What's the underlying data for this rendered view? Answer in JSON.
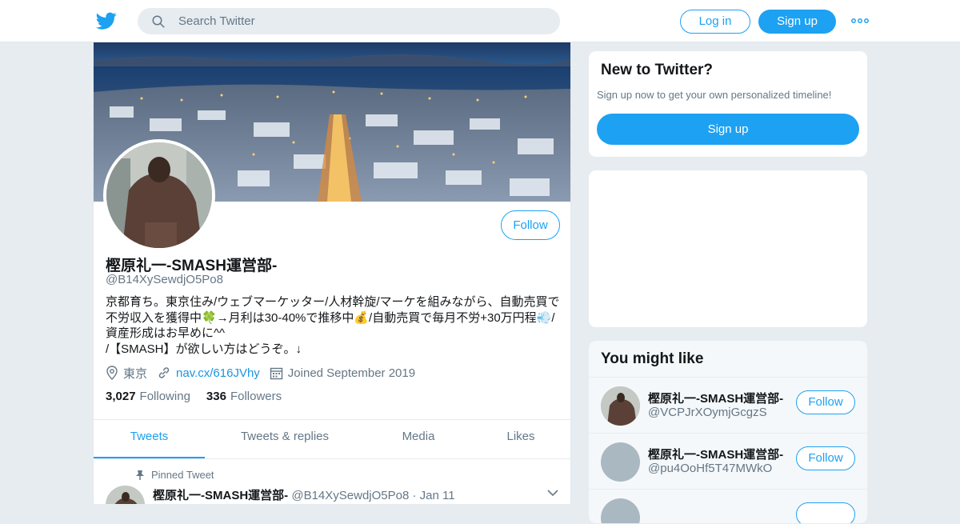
{
  "header": {
    "search_placeholder": "Search Twitter",
    "login_label": "Log in",
    "signup_label": "Sign up",
    "more_icon": "more-dots-icon"
  },
  "profile": {
    "name": "樫原礼一-SMASH運営部-",
    "handle": "@B14XySewdjO5Po8",
    "follow_label": "Follow",
    "bio_lines": [
      "京都育ち。東京住み/ウェブマーケッター/人材幹旋/マーケを組みながら、自動売買で",
      "不労収入を獲得中🍀→月利は30-40%で推移中💰/自動売買で毎月不労+30万円程💨/",
      "資産形成はお早めに^^",
      "/【SMASH】が欲しい方はどうぞ。↓"
    ],
    "location": "東京",
    "url": "nav.cx/616JVhy",
    "joined": "Joined September 2019",
    "following_count": "3,027",
    "following_label": "Following",
    "followers_count": "336",
    "followers_label": "Followers"
  },
  "tabs": [
    "Tweets",
    "Tweets & replies",
    "Media",
    "Likes"
  ],
  "pinned_tweet": {
    "label": "Pinned Tweet",
    "name": "樫原礼一-SMASH運営部-",
    "handle": "@B14XySewdjO5Po8",
    "separator": "·",
    "date": "Jan 11"
  },
  "new_to_twitter": {
    "title": "New to Twitter?",
    "subtitle": "Sign up now to get your own personalized timeline!",
    "button": "Sign up"
  },
  "you_might_like": {
    "title": "You might like",
    "items": [
      {
        "name": "樫原礼一-SMASH運営部-",
        "handle": "@VCPJrXOymjGcgzS",
        "button": "Follow"
      },
      {
        "name": "樫原礼一-SMASH運営部-",
        "handle": "@pu4OoHf5T47MWkO",
        "button": "Follow"
      }
    ]
  },
  "colors": {
    "accent": "#1da1f2",
    "background": "#e6ecf0",
    "secondary_text": "#657786"
  }
}
